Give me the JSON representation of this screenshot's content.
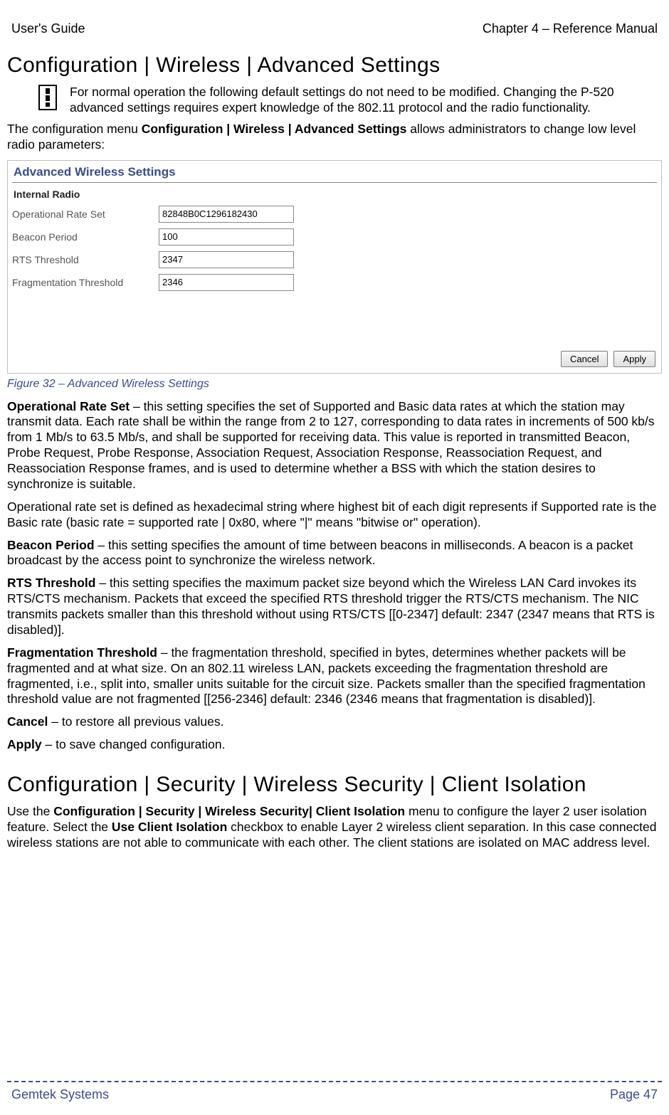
{
  "header": {
    "left": "User's Guide",
    "right": "Chapter 4 – Reference Manual"
  },
  "section1_heading": "Configuration | Wireless | Advanced Settings",
  "info_text": "For normal operation the following default settings do not need to be modified. Changing the P-520 advanced settings requires expert knowledge of the 802.11 protocol and the radio functionality.",
  "intro_pre": "The configuration menu ",
  "intro_bold": "Configuration | Wireless | Advanced Settings",
  "intro_post": " allows administrators to change low level radio parameters:",
  "panel": {
    "title": "Advanced Wireless Settings",
    "subtitle": "Internal Radio",
    "rows": [
      {
        "label": "Operational Rate Set",
        "value": "82848B0C1296182430"
      },
      {
        "label": "Beacon Period",
        "value": "100"
      },
      {
        "label": "RTS Threshold",
        "value": "2347"
      },
      {
        "label": "Fragmentation Threshold",
        "value": "2346"
      }
    ],
    "buttons": {
      "cancel": "Cancel",
      "apply": "Apply"
    }
  },
  "caption": "Figure 32 – Advanced Wireless Settings",
  "p_ors_bold": "Operational Rate Set",
  "p_ors_text": " – this setting specifies the set of Supported and Basic data rates at which the station may transmit data. Each rate shall be within the range from 2 to 127, corresponding to data rates in increments of 500 kb/s from 1 Mb/s to 63.5 Mb/s, and shall be supported for receiving data. This value is reported in transmitted Beacon, Probe Request, Probe Response, Association Request, Association Response, Reassociation Request, and Reassociation Response frames, and is used to determine whether a BSS with which the station desires to synchronize is suitable.",
  "p_ors2": "Operational rate set is defined as hexadecimal string where highest bit of each digit represents if Supported rate is the Basic rate (basic rate = supported rate | 0x80, where \"|\" means \"bitwise or\" operation).",
  "p_bp_bold": "Beacon Period",
  "p_bp_text": " – this setting specifies the amount of time between beacons in milliseconds. A beacon is a packet broadcast by the access point to synchronize the wireless network.",
  "p_rts_bold": "RTS Threshold",
  "p_rts_text": " – this setting specifies the maximum packet size beyond which the Wireless LAN Card invokes its RTS/CTS mechanism. Packets that exceed the specified RTS threshold trigger the RTS/CTS mechanism. The NIC transmits packets smaller than this threshold without using RTS/CTS [[0-2347] default: 2347 (2347 means that RTS is disabled)].",
  "p_ft_bold": "Fragmentation Threshold",
  "p_ft_text": " – the fragmentation threshold, specified in bytes, determines whether packets will be fragmented and at what size. On an 802.11 wireless LAN, packets exceeding the fragmentation threshold are fragmented, i.e., split into, smaller units suitable for the circuit size. Packets smaller than the specified fragmentation threshold value are not fragmented [[256-2346] default: 2346 (2346 means that fragmentation is disabled)].",
  "p_cancel_bold": "Cancel",
  "p_cancel_text": " – to restore all previous values.",
  "p_apply_bold": "Apply",
  "p_apply_text": " – to save changed configuration.",
  "section2_heading": "Configuration | Security | Wireless Security | Client Isolation",
  "p_iso_pre": "Use the ",
  "p_iso_bold1": "Configuration | Security | Wireless Security| Client Isolation",
  "p_iso_mid": " menu to configure the layer 2 user isolation feature. Select the ",
  "p_iso_bold2": "Use Client Isolation",
  "p_iso_post": " checkbox to enable Layer 2 wireless client separation. In this case connected wireless stations are not able to communicate with each other. The client stations are isolated on MAC address level.",
  "footer": {
    "left": "Gemtek Systems",
    "right": "Page 47"
  }
}
